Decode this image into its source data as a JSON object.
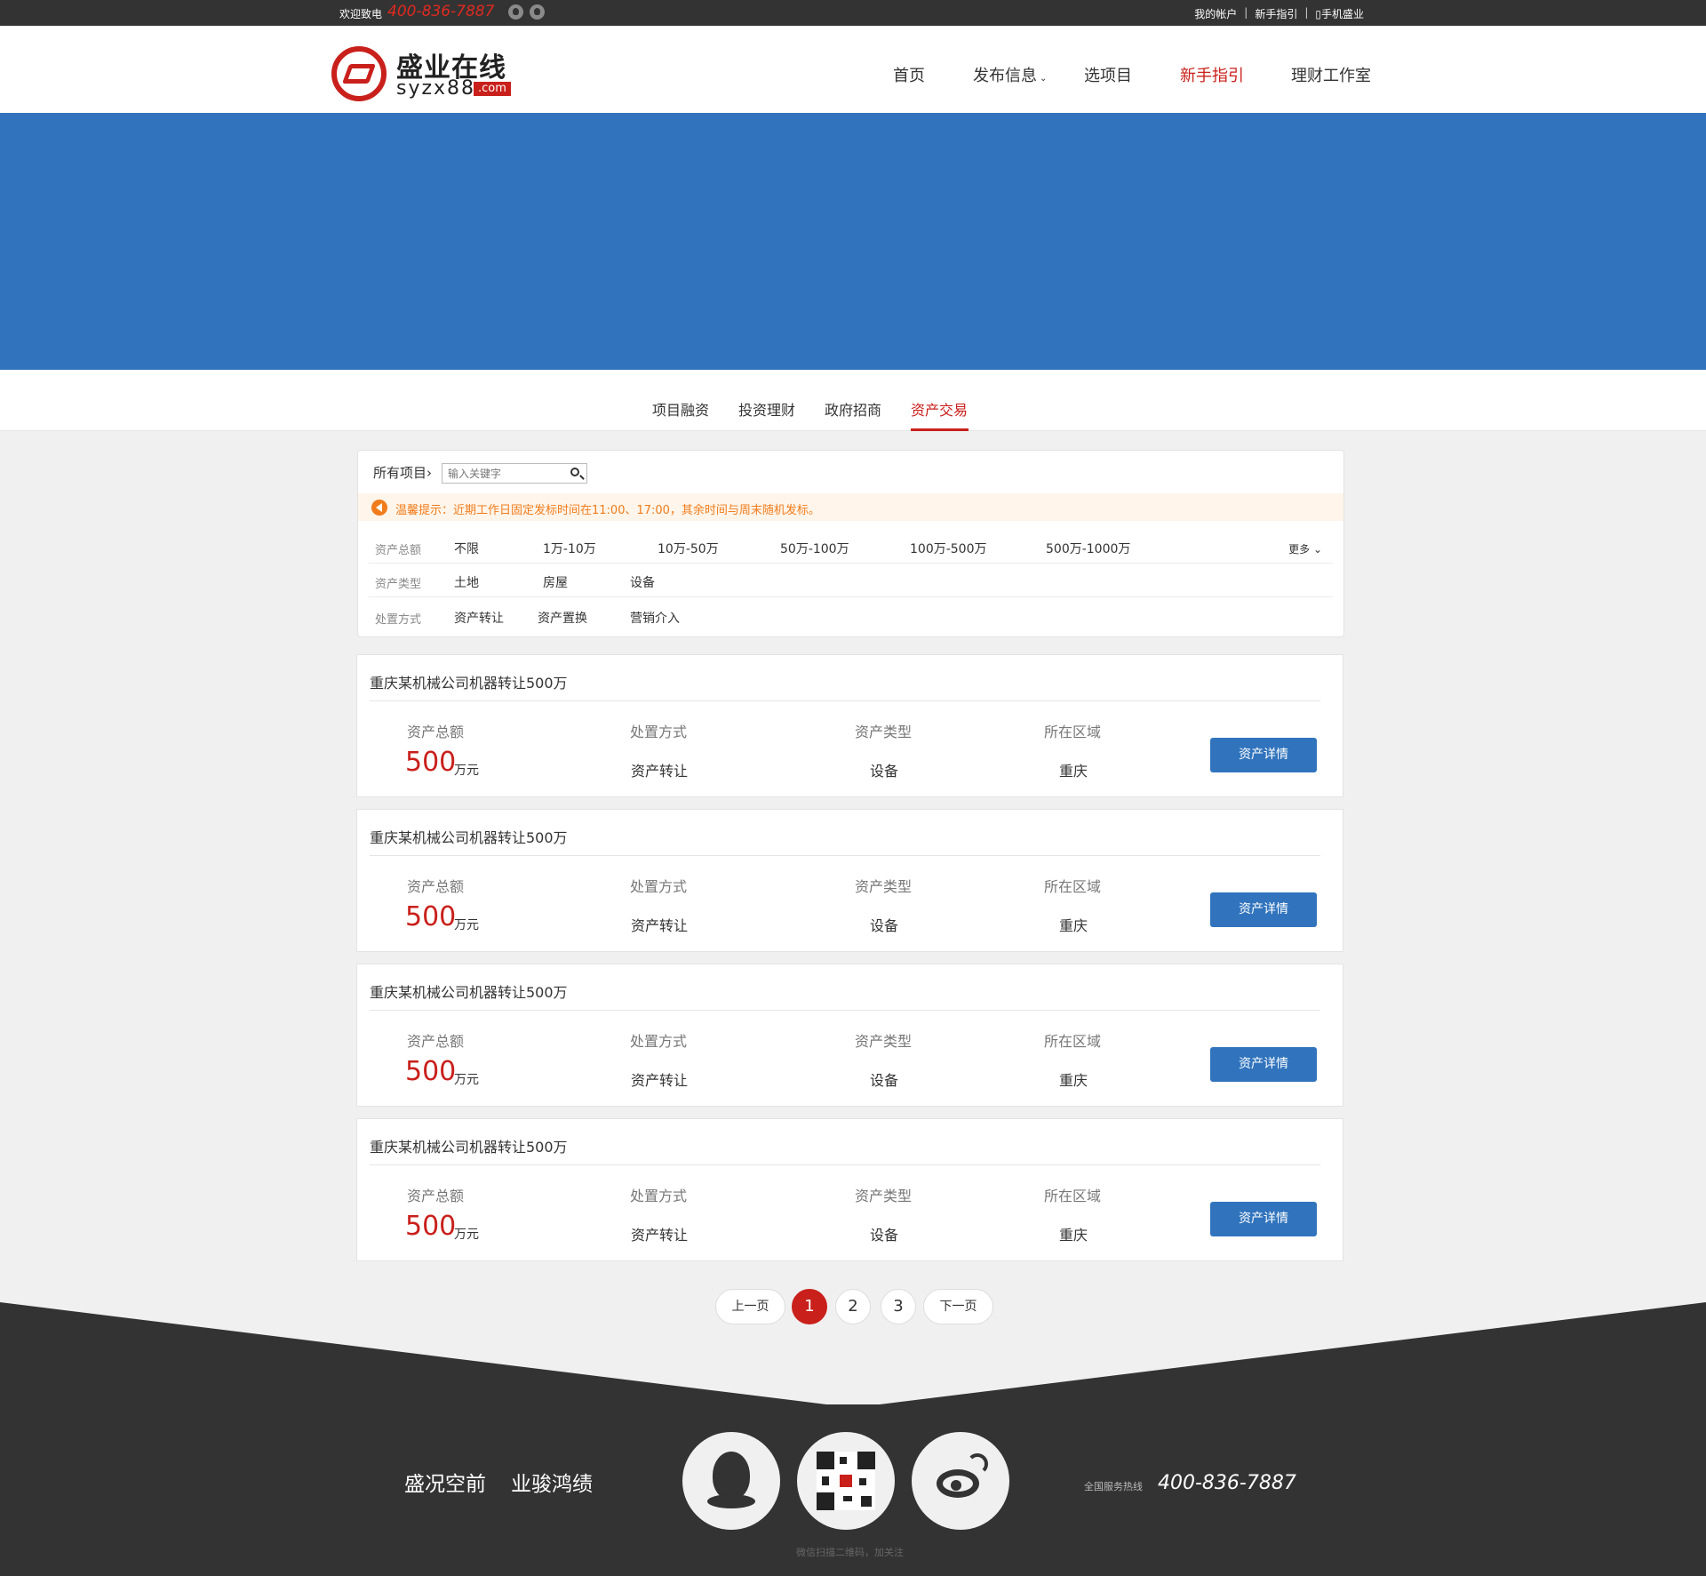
{
  "topbar": {
    "welcome": "欢迎致电",
    "phone": "400-836-7887",
    "icons": [
      "wechat-icon",
      "qq-icon"
    ],
    "links": [
      "我的帐户",
      "新手指引",
      "手机盛业"
    ]
  },
  "logo": {
    "cn": "盛业在线",
    "en": "syzx88",
    "com": ".com"
  },
  "nav": {
    "items": [
      {
        "label": "首页",
        "active": false
      },
      {
        "label": "发布信息",
        "active": false,
        "dropdown": true
      },
      {
        "label": "选项目",
        "active": false
      },
      {
        "label": "新手指引",
        "active": true
      },
      {
        "label": "理财工作室",
        "active": false
      }
    ]
  },
  "subtabs": {
    "items": [
      "项目融资",
      "投资理财",
      "政府招商",
      "资产交易"
    ],
    "active": "资产交易"
  },
  "filter": {
    "all_label": "所有项目",
    "search_placeholder": "输入关键字",
    "tip": "温馨提示：近期工作日固定发标时间在11:00、17:00，其余时间与周末随机发标。",
    "more": "更多",
    "rows": [
      {
        "label": "资产总额",
        "options": [
          "不限",
          "1万-10万",
          "10万-50万",
          "50万-100万",
          "100万-500万",
          "500万-1000万"
        ]
      },
      {
        "label": "资产类型",
        "options": [
          "土地",
          "房屋",
          "设备"
        ]
      },
      {
        "label": "处置方式",
        "options": [
          "资产转让",
          "资产置换",
          "营销介入"
        ]
      }
    ]
  },
  "projects": [
    {
      "title": "重庆某机械公司机器转让500万",
      "amount_label": "资产总额",
      "amount": "500",
      "unit": "万元",
      "method_label": "处置方式",
      "method": "资产转让",
      "type_label": "资产类型",
      "type": "设备",
      "region_label": "所在区域",
      "region": "重庆",
      "button": "资产详情"
    },
    {
      "title": "重庆某机械公司机器转让500万",
      "amount_label": "资产总额",
      "amount": "500",
      "unit": "万元",
      "method_label": "处置方式",
      "method": "资产转让",
      "type_label": "资产类型",
      "type": "设备",
      "region_label": "所在区域",
      "region": "重庆",
      "button": "资产详情"
    },
    {
      "title": "重庆某机械公司机器转让500万",
      "amount_label": "资产总额",
      "amount": "500",
      "unit": "万元",
      "method_label": "处置方式",
      "method": "资产转让",
      "type_label": "资产类型",
      "type": "设备",
      "region_label": "所在区域",
      "region": "重庆",
      "button": "资产详情"
    },
    {
      "title": "重庆某机械公司机器转让500万",
      "amount_label": "资产总额",
      "amount": "500",
      "unit": "万元",
      "method_label": "处置方式",
      "method": "资产转让",
      "type_label": "资产类型",
      "type": "设备",
      "region_label": "所在区域",
      "region": "重庆",
      "button": "资产详情"
    }
  ],
  "pagination": {
    "prev": "上一页",
    "pages": [
      "1",
      "2",
      "3"
    ],
    "current": "1",
    "next": "下一页"
  },
  "footer": {
    "slogan1": "盛况空前",
    "slogan2": "业骏鸿绩",
    "qr_caption": "微信扫描二维码，加关注",
    "hotline_label": "全国服务热线",
    "hotline": "400-836-7887",
    "icons": [
      "qq-icon",
      "qr-code",
      "weibo-icon"
    ]
  },
  "colors": {
    "brand_red": "#c9201b",
    "brand_blue": "#3174bd",
    "topbar": "#333333",
    "footer": "#333333",
    "tip_orange": "#f17c1c"
  }
}
